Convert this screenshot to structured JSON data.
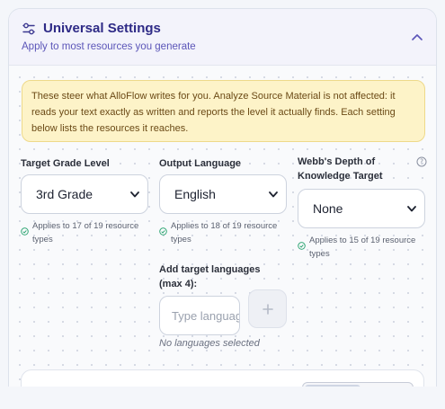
{
  "header": {
    "title": "Universal Settings",
    "subtitle": "Apply to most resources you generate",
    "icon": "sliders-icon",
    "collapse_icon": "chevron-up-icon"
  },
  "notice": {
    "text": "These steer what AlloFlow writes for you. Analyze Source Material is not affected: it reads your text exactly as written and reports the level it actually finds. Each setting below lists the resources it reaches."
  },
  "fields": {
    "grade": {
      "label": "Target Grade Level",
      "value": "3rd Grade",
      "applies": "Applies to 17 of 19 resource types"
    },
    "language": {
      "label": "Output Language",
      "value": "English",
      "applies": "Applies to 18 of 19 resource types"
    },
    "dok": {
      "label": "Webb's Depth of Knowledge Target",
      "value": "None",
      "applies": "Applies to 15 of 19 resource types"
    }
  },
  "target_languages": {
    "label": "Add target languages (max 4):",
    "placeholder": "Type language",
    "add_symbol": "+",
    "empty_text": "No languages selected"
  },
  "colors": {
    "title": "#2e2a86",
    "subtitle": "#5b55b8",
    "notice_bg": "#fdf3c8",
    "notice_text": "#6b4a16",
    "check": "#22a06b"
  }
}
